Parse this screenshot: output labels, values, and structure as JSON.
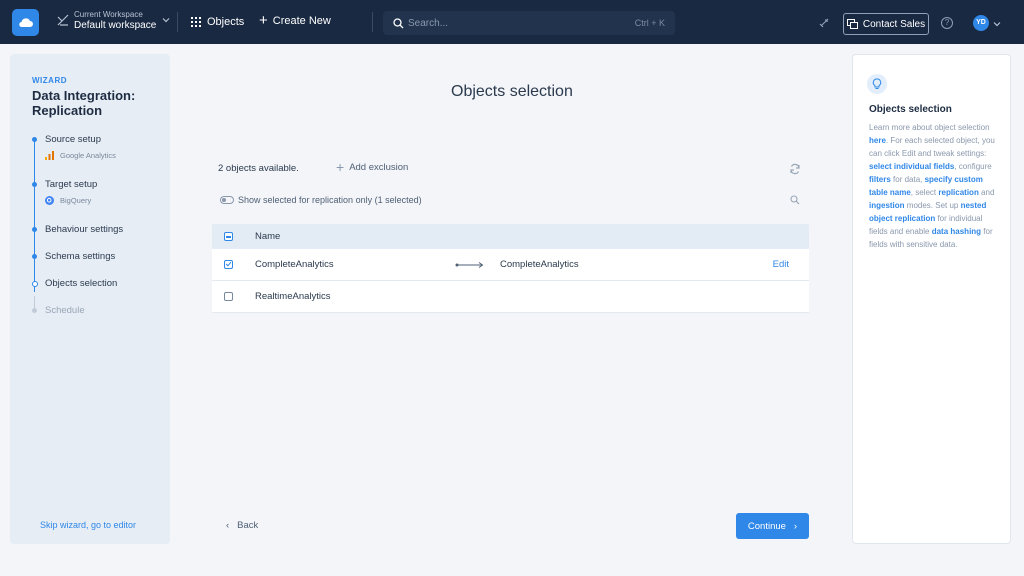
{
  "topbar": {
    "workspace_label": "Current Workspace",
    "workspace_name": "Default workspace",
    "objects": "Objects",
    "create_new": "Create New",
    "search_placeholder": "Search...",
    "search_shortcut": "Ctrl + K",
    "contact_sales": "Contact Sales",
    "avatar_initials": "YD"
  },
  "wizard": {
    "tag": "WIZARD",
    "title": "Data Integration: Replication",
    "steps": [
      {
        "label": "Source setup",
        "sub": "Google Analytics"
      },
      {
        "label": "Target setup",
        "sub": "BigQuery"
      },
      {
        "label": "Behaviour settings"
      },
      {
        "label": "Schema settings"
      },
      {
        "label": "Objects selection"
      },
      {
        "label": "Schedule"
      }
    ],
    "skip_link": "Skip wizard, go to editor"
  },
  "main": {
    "title": "Objects selection",
    "available": "2 objects available.",
    "add_exclusion": "Add exclusion",
    "toggle_label": "Show selected for replication only (1 selected)",
    "table": {
      "header_name": "Name",
      "rows": [
        {
          "name": "CompleteAnalytics",
          "target": "CompleteAnalytics",
          "action": "Edit",
          "checked": true
        },
        {
          "name": "RealtimeAnalytics",
          "target": "",
          "action": "",
          "checked": false
        }
      ]
    },
    "back": "Back",
    "continue": "Continue"
  },
  "help": {
    "title": "Objects selection",
    "parts": [
      "Learn more about object selection ",
      "here",
      ". For each selected object, you can click Edit and tweak settings: ",
      "select individual fields",
      ", configure ",
      "filters",
      " for data, ",
      "specify custom table name",
      ", select ",
      "replication",
      " and ",
      "ingestion",
      " modes. Set up ",
      "nested object replication",
      " for individual fields and enable ",
      "data hashing",
      " for fields with sensitive data."
    ]
  },
  "colors": {
    "topbar": "#192942",
    "accent": "#2f87e8",
    "wizard_bg": "#e6edf5"
  }
}
